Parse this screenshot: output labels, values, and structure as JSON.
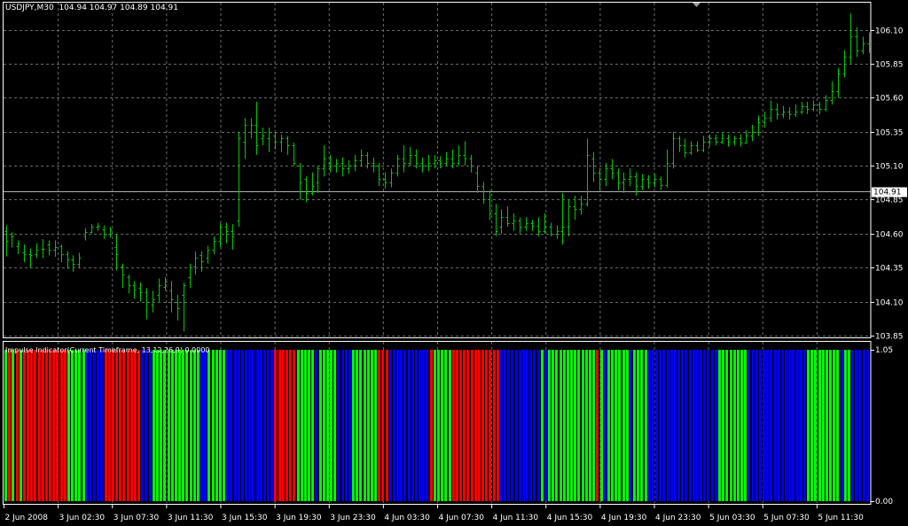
{
  "header": {
    "symbol": "USDJPY,M30",
    "ohlc": "104.94 104.97 104.89 104.91"
  },
  "colors": {
    "background": "#000000",
    "grid": "#6b6b6b",
    "bars": "#00c800",
    "frame": "#ffffff",
    "bear": "#ff0000",
    "bull": "#00ff00",
    "neutral": "#0000ff"
  },
  "chart_data": [
    {
      "type": "ohlc",
      "title": "USDJPY,M30  104.94 104.97 104.89 104.91",
      "y_ticks": [
        "106.10",
        "105.85",
        "105.60",
        "105.35",
        "105.10",
        "104.85",
        "104.60",
        "104.35",
        "104.10",
        "103.85"
      ],
      "ylim": [
        103.83,
        106.3
      ],
      "current_price": "104.91",
      "x_ticks": [
        "2 Jun 2008",
        "3 Jun 02:30",
        "3 Jun 07:30",
        "3 Jun 11:30",
        "3 Jun 15:30",
        "3 Jun 19:30",
        "3 Jun 23:30",
        "4 Jun 03:30",
        "4 Jun 07:30",
        "4 Jun 11:30",
        "4 Jun 15:30",
        "4 Jun 19:30",
        "4 Jun 23:30",
        "5 Jun 03:30",
        "5 Jun 07:30",
        "5 Jun 11:30"
      ],
      "bars": [
        [
          104.62,
          104.55,
          104.66,
          104.43
        ],
        [
          104.6,
          104.58,
          104.61,
          104.5
        ],
        [
          104.51,
          104.53,
          104.55,
          104.45
        ],
        [
          104.46,
          104.45,
          104.52,
          104.39
        ],
        [
          104.45,
          104.44,
          104.49,
          104.35
        ],
        [
          104.45,
          104.48,
          104.53,
          104.42
        ],
        [
          104.49,
          104.49,
          104.56,
          104.42
        ],
        [
          104.52,
          104.48,
          104.55,
          104.44
        ],
        [
          104.48,
          104.5,
          104.55,
          104.43
        ],
        [
          104.51,
          104.45,
          104.52,
          104.39
        ],
        [
          104.45,
          104.41,
          104.47,
          104.34
        ],
        [
          104.41,
          104.38,
          104.44,
          104.32
        ],
        [
          104.38,
          104.42,
          104.46,
          104.35
        ],
        [
          104.58,
          104.61,
          104.64,
          104.55
        ],
        [
          104.61,
          104.65,
          104.67,
          104.6
        ],
        [
          104.65,
          104.66,
          104.68,
          104.62
        ],
        [
          104.63,
          104.6,
          104.66,
          104.56
        ],
        [
          104.6,
          104.63,
          104.65,
          104.57
        ],
        [
          104.5,
          104.45,
          104.6,
          104.33
        ],
        [
          104.36,
          104.3,
          104.38,
          104.2
        ],
        [
          104.28,
          104.22,
          104.3,
          104.16
        ],
        [
          104.22,
          104.19,
          104.25,
          104.12
        ],
        [
          104.2,
          104.17,
          104.24,
          104.1
        ],
        [
          104.17,
          104.1,
          104.2,
          103.97
        ],
        [
          104.08,
          104.12,
          104.18,
          104.02
        ],
        [
          104.15,
          104.22,
          104.27,
          104.1
        ],
        [
          104.21,
          104.25,
          104.28,
          104.18
        ],
        [
          104.18,
          104.12,
          104.25,
          104.02
        ],
        [
          104.1,
          104.05,
          104.15,
          103.96
        ],
        [
          104.15,
          104.22,
          104.24,
          103.88
        ],
        [
          104.28,
          104.35,
          104.38,
          104.2
        ],
        [
          104.36,
          104.42,
          104.47,
          104.3
        ],
        [
          104.44,
          104.4,
          104.47,
          104.32
        ],
        [
          104.42,
          104.48,
          104.51,
          104.38
        ],
        [
          104.48,
          104.55,
          104.58,
          104.45
        ],
        [
          104.55,
          104.65,
          104.68,
          104.5
        ],
        [
          104.65,
          104.62,
          104.68,
          104.53
        ],
        [
          104.62,
          104.58,
          104.67,
          104.48
        ],
        [
          104.7,
          105.3,
          105.35,
          104.65
        ],
        [
          105.28,
          105.4,
          105.45,
          105.15
        ],
        [
          105.35,
          105.4,
          105.45,
          105.3
        ],
        [
          105.4,
          105.25,
          105.57,
          105.18
        ],
        [
          105.3,
          105.32,
          105.38,
          105.25
        ],
        [
          105.3,
          105.35,
          105.38,
          105.2
        ],
        [
          105.32,
          105.28,
          105.35,
          105.22
        ],
        [
          105.28,
          105.3,
          105.33,
          105.2
        ],
        [
          105.3,
          105.25,
          105.32,
          105.18
        ],
        [
          105.25,
          105.12,
          105.27,
          105.1
        ],
        [
          105.1,
          104.98,
          105.12,
          104.85
        ],
        [
          105.0,
          104.9,
          105.02,
          104.83
        ],
        [
          104.9,
          104.95,
          105.05,
          104.88
        ],
        [
          104.98,
          105.08,
          105.1,
          104.9
        ],
        [
          105.08,
          105.15,
          105.25,
          105.02
        ],
        [
          105.12,
          105.1,
          105.18,
          105.05
        ],
        [
          105.1,
          105.12,
          105.15,
          105.05
        ],
        [
          105.12,
          105.08,
          105.16,
          105.02
        ],
        [
          105.08,
          105.1,
          105.14,
          105.04
        ],
        [
          105.1,
          105.14,
          105.18,
          105.06
        ],
        [
          105.14,
          105.18,
          105.22,
          105.1
        ],
        [
          105.18,
          105.12,
          105.2,
          105.08
        ],
        [
          105.12,
          105.1,
          105.16,
          105.05
        ],
        [
          105.1,
          105.0,
          105.12,
          104.95
        ],
        [
          105.0,
          104.98,
          105.05,
          104.93
        ],
        [
          104.98,
          105.05,
          105.08,
          104.94
        ],
        [
          105.05,
          105.15,
          105.18,
          105.02
        ],
        [
          105.15,
          105.12,
          105.25,
          105.05
        ],
        [
          105.12,
          105.18,
          105.24,
          105.1
        ],
        [
          105.18,
          105.12,
          105.22,
          105.08
        ],
        [
          105.12,
          105.1,
          105.16,
          105.05
        ],
        [
          105.1,
          105.12,
          105.18,
          105.06
        ],
        [
          105.12,
          105.14,
          105.18,
          105.08
        ],
        [
          105.14,
          105.12,
          105.17,
          105.08
        ],
        [
          105.12,
          105.15,
          105.2,
          105.1
        ],
        [
          105.15,
          105.12,
          105.22,
          105.08
        ],
        [
          105.12,
          105.18,
          105.25,
          105.1
        ],
        [
          105.18,
          105.15,
          105.28,
          105.1
        ],
        [
          105.15,
          105.1,
          105.18,
          105.05
        ],
        [
          105.05,
          104.95,
          105.1,
          104.9
        ],
        [
          104.95,
          104.85,
          104.98,
          104.82
        ],
        [
          104.85,
          104.75,
          104.92,
          104.7
        ],
        [
          104.75,
          104.62,
          104.82,
          104.58
        ],
        [
          104.65,
          104.72,
          104.78,
          104.6
        ],
        [
          104.72,
          104.68,
          104.8,
          104.65
        ],
        [
          104.68,
          104.7,
          104.75,
          104.62
        ],
        [
          104.7,
          104.65,
          104.72,
          104.6
        ],
        [
          104.65,
          104.68,
          104.72,
          104.62
        ],
        [
          104.68,
          104.66,
          104.7,
          104.62
        ],
        [
          104.66,
          104.62,
          104.72,
          104.58
        ],
        [
          104.62,
          104.65,
          104.75,
          104.6
        ],
        [
          104.65,
          104.6,
          104.68,
          104.58
        ],
        [
          104.6,
          104.62,
          104.66,
          104.56
        ],
        [
          104.62,
          104.65,
          104.9,
          104.52
        ],
        [
          104.65,
          104.8,
          104.85,
          104.58
        ],
        [
          104.8,
          104.78,
          104.88,
          104.7
        ],
        [
          104.78,
          104.82,
          104.88,
          104.74
        ],
        [
          104.82,
          105.18,
          105.3,
          104.8
        ],
        [
          105.15,
          105.05,
          105.2,
          104.98
        ],
        [
          105.05,
          105.0,
          105.08,
          104.92
        ],
        [
          105.0,
          105.08,
          105.12,
          104.95
        ],
        [
          105.08,
          105.05,
          105.15,
          105.0
        ],
        [
          105.05,
          104.98,
          105.08,
          104.92
        ],
        [
          104.98,
          105.0,
          105.05,
          104.9
        ],
        [
          105.0,
          105.02,
          105.08,
          104.95
        ],
        [
          105.02,
          104.95,
          105.05,
          104.88
        ],
        [
          104.95,
          105.0,
          105.04,
          104.92
        ],
        [
          105.0,
          104.98,
          105.03,
          104.93
        ],
        [
          104.98,
          105.0,
          105.04,
          104.94
        ],
        [
          105.0,
          104.96,
          105.02,
          104.92
        ],
        [
          104.96,
          105.12,
          105.22,
          104.94
        ],
        [
          105.12,
          105.3,
          105.35,
          105.08
        ],
        [
          105.3,
          105.25,
          105.32,
          105.2
        ],
        [
          105.25,
          105.2,
          105.3,
          105.16
        ],
        [
          105.2,
          105.25,
          105.28,
          105.18
        ],
        [
          105.25,
          105.22,
          105.28,
          105.2
        ],
        [
          105.22,
          105.28,
          105.32,
          105.2
        ],
        [
          105.28,
          105.3,
          105.33,
          105.24
        ],
        [
          105.3,
          105.28,
          105.33,
          105.25
        ],
        [
          105.28,
          105.3,
          105.34,
          105.26
        ],
        [
          105.3,
          105.28,
          105.33,
          105.24
        ],
        [
          105.28,
          105.3,
          105.32,
          105.25
        ],
        [
          105.3,
          105.27,
          105.33,
          105.24
        ],
        [
          105.27,
          105.32,
          105.36,
          105.26
        ],
        [
          105.32,
          105.35,
          105.4,
          105.28
        ],
        [
          105.35,
          105.42,
          105.47,
          105.32
        ],
        [
          105.42,
          105.45,
          105.5,
          105.38
        ],
        [
          105.45,
          105.52,
          105.58,
          105.42
        ],
        [
          105.52,
          105.48,
          105.56,
          105.44
        ],
        [
          105.48,
          105.5,
          105.54,
          105.45
        ],
        [
          105.5,
          105.48,
          105.53,
          105.44
        ],
        [
          105.48,
          105.5,
          105.55,
          105.46
        ],
        [
          105.5,
          105.54,
          105.57,
          105.48
        ],
        [
          105.54,
          105.52,
          105.57,
          105.48
        ],
        [
          105.52,
          105.55,
          105.58,
          105.5
        ],
        [
          105.55,
          105.52,
          105.57,
          105.48
        ],
        [
          105.52,
          105.58,
          105.62,
          105.5
        ],
        [
          105.58,
          105.65,
          105.72,
          105.55
        ],
        [
          105.65,
          105.78,
          105.82,
          105.6
        ],
        [
          105.78,
          105.9,
          105.95,
          105.75
        ],
        [
          105.9,
          106.05,
          106.22,
          105.85
        ],
        [
          106.05,
          105.95,
          106.12,
          105.9
        ],
        [
          105.95,
          106.0,
          106.05,
          105.92
        ],
        [
          106.0,
          105.96,
          106.08,
          105.93
        ]
      ]
    },
    {
      "type": "bar",
      "title": "Impulse Indicator(Current Timeframe, 13,12,26,9) 0.0000",
      "y_ticks": [
        "1.05",
        "0.00"
      ],
      "value": 1.05,
      "states": "GRGRGRRRRRRRRRRRRGGGGGBBBBBRRRRRRRRRRBBBGGGGGGGGGGGGGBBGGGGGBBBBBBBBBBBBBRRRRRRGGGGGBGGGGGBBBBGGGGGGGRRRBBBBBBBBBBBRGGGGGRRRRRRRRRRRRRBBBBBBBBBBBGBGGGGGGGGGGGGGRGBGGGGGGBGGGGBBBBBBBBBBBBBBBBBBBGGGGGGGGBBBBBBBBBBBBBBBBGGGGGGGGGBGGBBBBB"
    }
  ]
}
